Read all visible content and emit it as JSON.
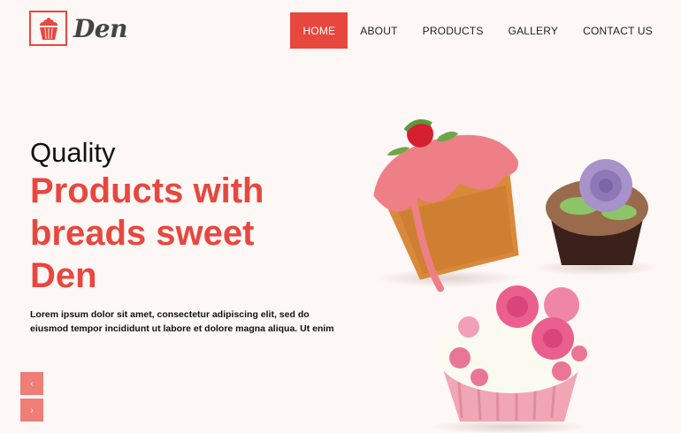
{
  "brand": {
    "name": "Den"
  },
  "nav": {
    "items": [
      {
        "label": "HOME",
        "active": true
      },
      {
        "label": "ABOUT",
        "active": false
      },
      {
        "label": "PRODUCTS",
        "active": false
      },
      {
        "label": "GALLERY",
        "active": false
      },
      {
        "label": "CONTACT US",
        "active": false
      }
    ]
  },
  "hero": {
    "pre_title": "Quality",
    "title": "Products with breads sweet Den",
    "description": "Lorem ipsum dolor sit amet, consectetur adipiscing elit, sed do eiusmod tempor incididunt ut labore et dolore magna aliqua. Ut enim"
  },
  "slider": {
    "prev_label": "‹",
    "next_label": "›"
  },
  "colors": {
    "accent": "#e8473e",
    "background": "#fdf7f6",
    "slider_button": "#ef7e77"
  }
}
